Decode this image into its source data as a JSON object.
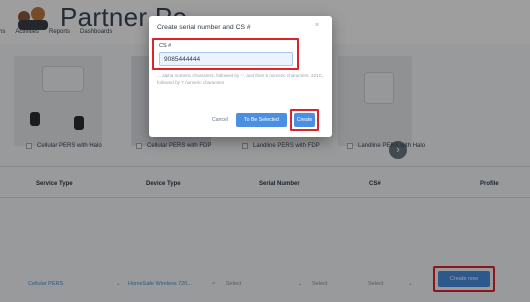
{
  "header": {
    "brand": "Partner Po",
    "nav": [
      "ns",
      "Activities",
      "Reports",
      "Dashboards"
    ]
  },
  "products": [
    {
      "label": "Cellular PERS with Halo"
    },
    {
      "label": "Cellular PERS with FDP"
    },
    {
      "label": "Landline PERS with FDP"
    },
    {
      "label": "Landline PERS with Halo"
    }
  ],
  "table": {
    "headers": [
      "Service Type",
      "Device Type",
      "Serial Number",
      "CS#",
      "Profile"
    ]
  },
  "filters": {
    "service": "Cellular PERS",
    "device": "HomeSafe Wireless 720...",
    "select1": "Select",
    "select2": "Select",
    "select3": "Select",
    "create_now": "Create now"
  },
  "modal": {
    "title": "Create serial number and CS #",
    "close": "×",
    "cs_label": "CS #",
    "cs_value": "9085444444",
    "hint": "... alpha numeric characters, followed by '-', and then 5 numeric characters. 321C, followed by 7 numeric characters",
    "cancel": "Cancel",
    "to_be_selected": "To Be Selected",
    "create": "Create"
  },
  "colors": {
    "accent": "#4a8fe2",
    "highlight": "#e0222a"
  }
}
